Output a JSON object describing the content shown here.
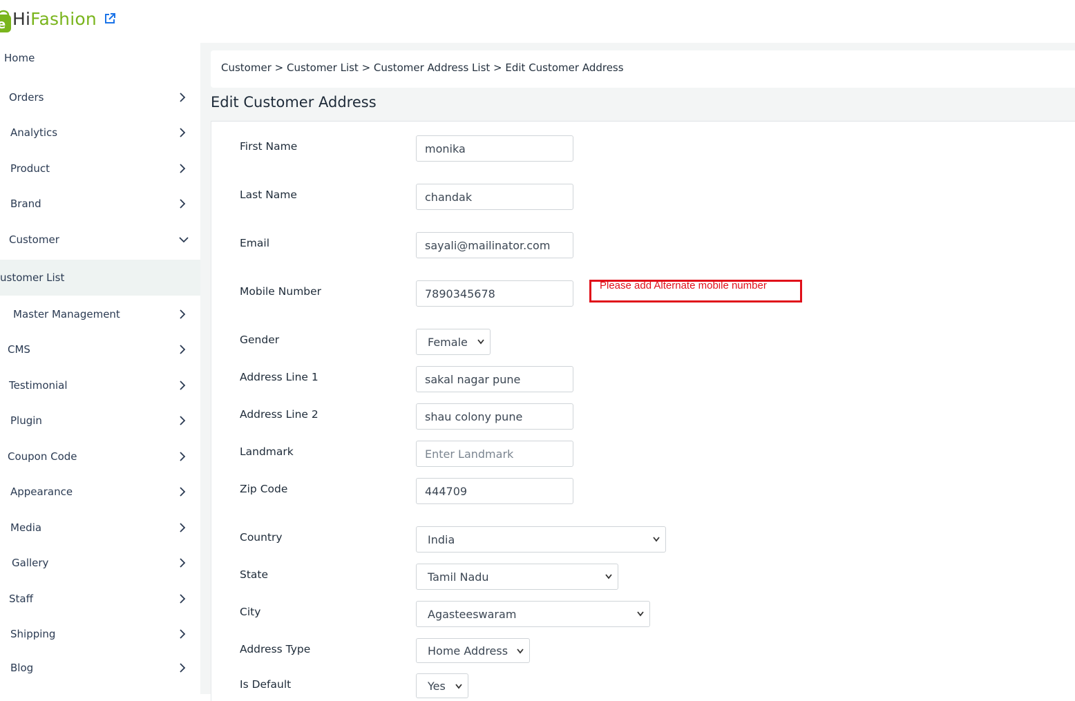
{
  "app": {
    "brand_hi": "Hi",
    "brand_rest": "Fashion"
  },
  "sidebar": {
    "items": [
      {
        "label": "Home",
        "chevron": "none"
      },
      {
        "label": "Orders",
        "chevron": "right"
      },
      {
        "label": "Analytics",
        "chevron": "right"
      },
      {
        "label": "Product",
        "chevron": "right"
      },
      {
        "label": "Brand",
        "chevron": "right"
      },
      {
        "label": "Customer",
        "chevron": "down"
      },
      {
        "label": "ustomer List",
        "chevron": "none",
        "active": true
      },
      {
        "label": "Master Management",
        "chevron": "right"
      },
      {
        "label": "CMS",
        "chevron": "right"
      },
      {
        "label": "Testimonial",
        "chevron": "right"
      },
      {
        "label": "Plugin",
        "chevron": "right"
      },
      {
        "label": "Coupon Code",
        "chevron": "right"
      },
      {
        "label": "Appearance",
        "chevron": "right"
      },
      {
        "label": "Media",
        "chevron": "right"
      },
      {
        "label": "Gallery",
        "chevron": "right"
      },
      {
        "label": "Staff",
        "chevron": "right"
      },
      {
        "label": "Shipping",
        "chevron": "right"
      },
      {
        "label": "Blog",
        "chevron": "right"
      }
    ]
  },
  "breadcrumb": "Customer > Customer List > Customer Address List > Edit Customer Address",
  "page_title": "Edit Customer Address",
  "form": {
    "first_name": {
      "label": "First Name",
      "value": "monika"
    },
    "last_name": {
      "label": "Last Name",
      "value": "chandak"
    },
    "email": {
      "label": "Email",
      "value": "sayali@mailinator.com"
    },
    "mobile": {
      "label": "Mobile Number",
      "value": "7890345678"
    },
    "gender": {
      "label": "Gender",
      "value": "Female"
    },
    "address1": {
      "label": "Address Line 1",
      "value": "sakal nagar pune"
    },
    "address2": {
      "label": "Address Line 2",
      "value": "shau colony pune"
    },
    "landmark": {
      "label": "Landmark",
      "placeholder": "Enter Landmark"
    },
    "zip": {
      "label": "Zip Code",
      "value": "444709"
    },
    "country": {
      "label": "Country",
      "value": "India"
    },
    "state": {
      "label": "State",
      "value": "Tamil Nadu"
    },
    "city": {
      "label": "City",
      "value": "Agasteeswaram"
    },
    "address_type": {
      "label": "Address Type",
      "value": "Home Address"
    },
    "is_default": {
      "label": "Is Default",
      "value": "Yes"
    }
  },
  "annotation": {
    "text": "Please add Alternate mobile number",
    "color": "#e0101a"
  },
  "colors": {
    "brand_green": "#7ab51d",
    "link_blue": "#1a73e8",
    "active_bg": "#eef3f2"
  }
}
